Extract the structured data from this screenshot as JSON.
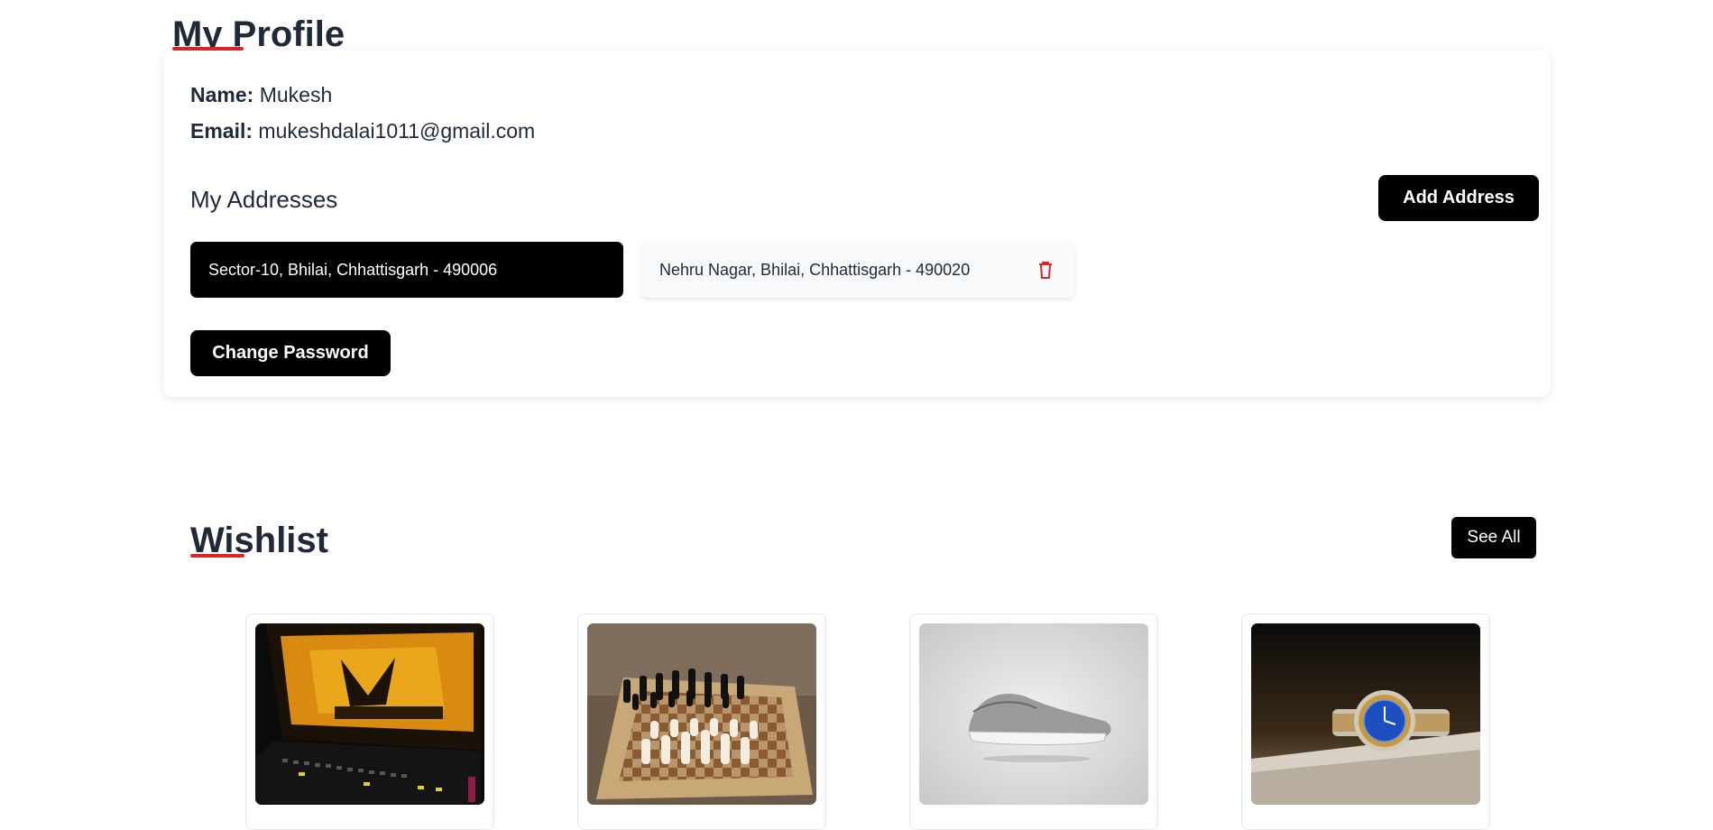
{
  "profile": {
    "title": "My Profile",
    "name_label": "Name:",
    "name_value": "Mukesh",
    "email_label": "Email:",
    "email_value": "mukeshdalai1011@gmail.com",
    "addresses_heading": "My Addresses",
    "add_address_label": "Add Address",
    "change_password_label": "Change Password",
    "addresses": [
      {
        "text": "Sector-10, Bhilai, Chhattisgarh - 490006",
        "selected": true
      },
      {
        "text": "Nehru Nagar, Bhilai, Chhattisgarh - 490020",
        "selected": false
      }
    ]
  },
  "wishlist": {
    "title": "Wishlist",
    "see_all_label": "See All",
    "products": [
      {
        "image": "gaming-laptop"
      },
      {
        "image": "chess-board"
      },
      {
        "image": "sneaker"
      },
      {
        "image": "wrist-watch"
      }
    ]
  },
  "colors": {
    "accent_underline": "#dc2626",
    "button_bg": "#000000",
    "text": "#1f2937"
  }
}
